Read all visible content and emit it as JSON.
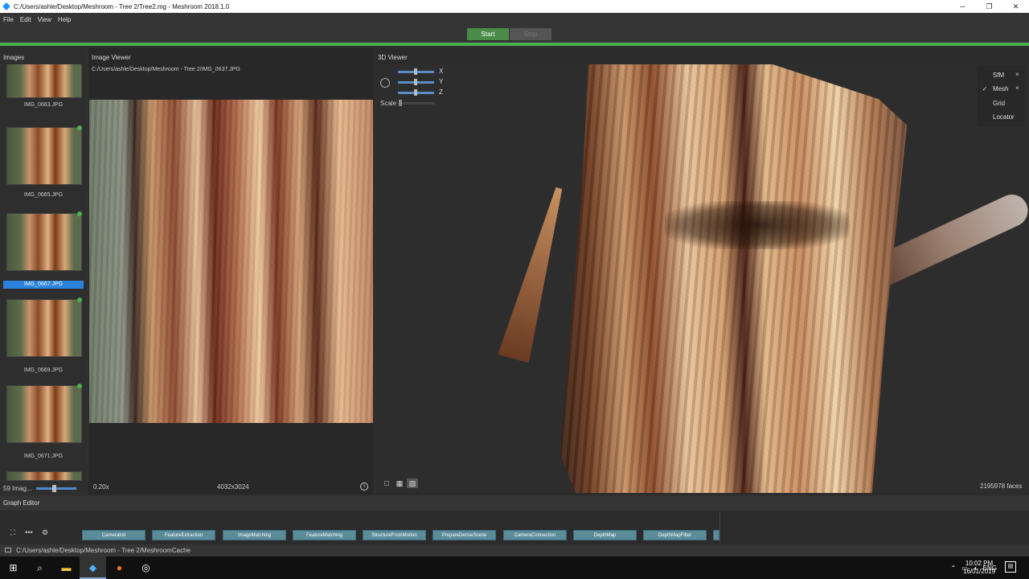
{
  "window": {
    "title": "C:/Users/ashle/Desktop/Meshroom - Tree 2/Tree2.mg - Meshroom 2018.1.0",
    "minimize": "─",
    "restore": "❐",
    "close": "✕"
  },
  "menu": [
    "File",
    "Edit",
    "View",
    "Help"
  ],
  "run": {
    "start_label": "Start",
    "stop_label": "Stop",
    "accent": "#4caf50"
  },
  "images_panel": {
    "title": "Images",
    "thumbnails": [
      {
        "label": "IMG_0663.JPG",
        "selected": false
      },
      {
        "label": "IMG_0665.JPG",
        "selected": false
      },
      {
        "label": "IMG_0667.JPG",
        "selected": true
      },
      {
        "label": "IMG_0669.JPG",
        "selected": false
      },
      {
        "label": "IMG_0671.JPG",
        "selected": false
      }
    ],
    "count_label": "59 Imag..."
  },
  "image_viewer": {
    "title": "Image Viewer",
    "path": "C:/Users/ashle/Desktop/Meshroom - Tree 2/IMG_0637.JPG",
    "zoom": "0.20x",
    "dimensions": "4032x3024",
    "info_icon": "i"
  },
  "viewer3d": {
    "title": "3D Viewer",
    "axes": [
      "X",
      "Y",
      "Z"
    ],
    "scale_label": "Scale",
    "layers": [
      {
        "name": "SfM",
        "checked": false,
        "check": "",
        "closable": true
      },
      {
        "name": "Mesh",
        "checked": true,
        "check": "✓",
        "closable": true
      },
      {
        "name": "Grid",
        "checked": false,
        "check": "",
        "closable": false
      },
      {
        "name": "Locator",
        "checked": false,
        "check": "",
        "closable": false
      }
    ],
    "faces": "2195978 faces",
    "close_glyph": "×"
  },
  "graph_editor": {
    "title": "Graph Editor",
    "nodes": [
      "CameraInit",
      "FeatureExtraction",
      "ImageMatching",
      "FeatureMatching",
      "StructureFromMotion",
      "PrepareDenseScene",
      "CameraConnection",
      "DepthMap",
      "DepthMapFilter"
    ]
  },
  "cache_path": "C:/Users/ashle/Desktop/Meshroom - Tree 2/MeshroomCache",
  "taskbar": {
    "lang": "ENG",
    "time": "10:02 PM",
    "date": "16/01/2019"
  }
}
